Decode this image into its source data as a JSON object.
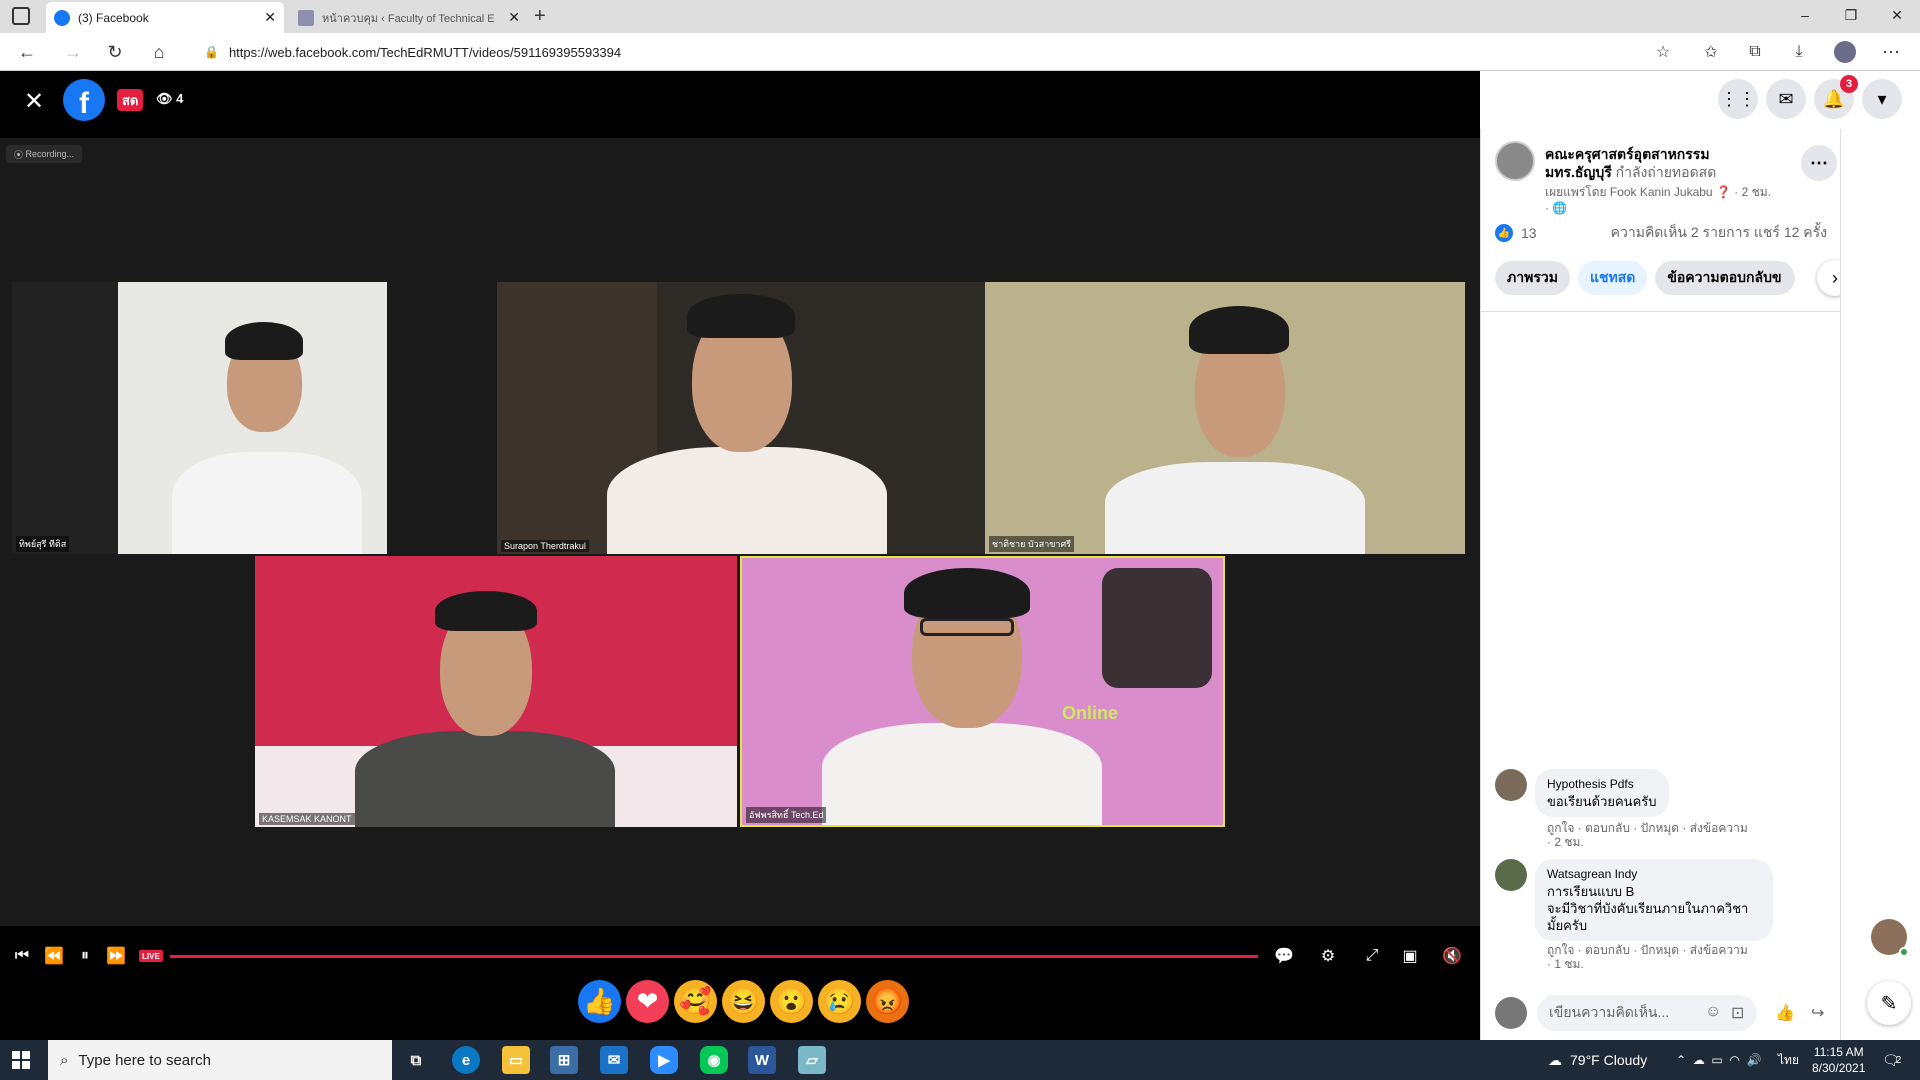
{
  "browser": {
    "tabs": [
      {
        "title": "(3) Facebook",
        "active": true
      },
      {
        "title": "หน้าควบคุม ‹ Faculty of Technical E",
        "active": false
      }
    ],
    "new_tab": "+",
    "url": "https://web.facebook.com/TechEdRMUTT/videos/591169395593394",
    "window_controls": {
      "minimize": "–",
      "restore": "❐",
      "close": "✕"
    }
  },
  "video": {
    "close_icon": "✕",
    "logo": "f",
    "live_badge": "สด",
    "viewer_count": "4",
    "recording_label": "Recording...",
    "tiles": [
      {
        "name": "ทิพย์สุรี ทีติส"
      },
      {
        "name": "Surapon Therdtrakul"
      },
      {
        "name": "ชาติชาย บัวสาขาศรี"
      },
      {
        "name": "KASEMSAK KANONT"
      },
      {
        "name": "อัฟพรสิทธิ์ Tech.Ed"
      }
    ],
    "banner_text": "Online",
    "live_mini": "LIVE",
    "reactions": [
      "👍",
      "❤",
      "🥰",
      "😆",
      "😮",
      "😢",
      "😡"
    ]
  },
  "fb_topbar": {
    "notifications_count": "3"
  },
  "post": {
    "page_name": "คณะครุศาสตร์อุตสาหกรรม มทร.ธัญบุรี",
    "status": "กำลังถ่ายทอดสด",
    "published_by": "เผยแพร่โดย Fook Kanin Jukabu",
    "time": "2 ชม.",
    "like_count": "13",
    "comments_shares": "ความคิดเห็น 2 รายการ  แชร์ 12 ครั้ง",
    "tabs": [
      "ภาพรวม",
      "แชทสด",
      "ข้อความตอบกลับข"
    ]
  },
  "comments": [
    {
      "author": "Hypothesis Pdfs",
      "text": "ขอเรียนด้วยคนครับ",
      "actions": "ถูกใจ · ตอบกลับ · ปักหมุด · ส่งข้อความ",
      "time": "· 2 ชม."
    },
    {
      "author": "Watsagrean Indy",
      "text_lines": [
        "การเรียนแบบ B",
        "จะมีวิชาที่บังคับเรียนภายในภาควิชา",
        "มั้ยครับ"
      ],
      "actions": "ถูกใจ · ตอบกลับ · ปักหมุด · ส่งข้อความ",
      "time": "· 1 ชม."
    }
  ],
  "compose": {
    "placeholder": "เขียนความคิดเห็น..."
  },
  "taskbar": {
    "search_placeholder": "Type here to search",
    "weather": "79°F  Cloudy",
    "language": "ไทย",
    "time": "11:15 AM",
    "date": "8/30/2021",
    "notification_badge": "2"
  }
}
